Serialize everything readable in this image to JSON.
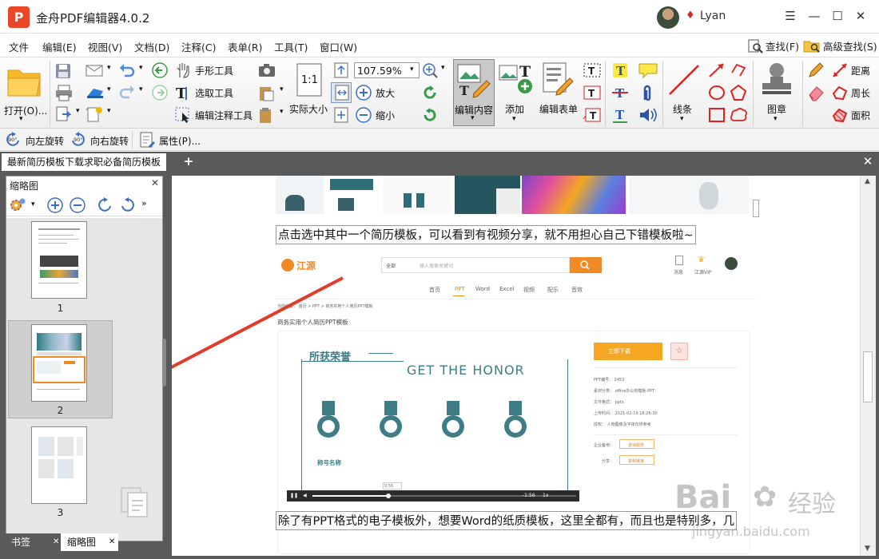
{
  "app": {
    "title": "金舟PDF编辑器4.0.2",
    "logo_letter": "P",
    "username": "Lyan"
  },
  "menu": {
    "items": [
      "文件",
      "编辑(E)",
      "视图(V)",
      "文档(D)",
      "注释(C)",
      "表单(R)",
      "工具(T)",
      "窗口(W)"
    ],
    "find": "查找(F)",
    "advanced_find": "高级查找(S)"
  },
  "ribbon": {
    "open": "打开(O)...",
    "hand_tool": "手形工具",
    "select_tool": "选取工具",
    "edit_annotation_tool": "编辑注释工具",
    "actual_size": "实际大小",
    "zoom_value": "107.59%",
    "zoom_in": "放大",
    "zoom_out": "缩小",
    "edit_content": "编辑内容",
    "add": "添加",
    "edit_form": "编辑表单",
    "line": "线条",
    "stamp": "图章",
    "distance": "距离",
    "perimeter": "周长",
    "area": "面积",
    "text_icon_letter": "T",
    "actual_size_icon": "1:1"
  },
  "toolbar2": {
    "rotate_left": "向左旋转",
    "rotate_right": "向右旋转",
    "properties": "属性(P)...",
    "rotate_badge": "90°"
  },
  "document": {
    "tab_title": "最新简历模板下载求职必备简历模板",
    "caption_1": "点击选中其中一个简历模板，可以看到有视频分享，就不用担心自己下错模板啦~",
    "caption_2": "除了有PPT格式的电子模板外，想要Word的纸质模板，这里全都有，而且也是特别多，几"
  },
  "thumbnails": {
    "panel_title": "缩略图",
    "pages": [
      "1",
      "2",
      "3"
    ],
    "selected_page": "2",
    "bottom_tabs": [
      "书签",
      "缩略图"
    ]
  },
  "embedded_site": {
    "logo": "江源",
    "search_category": "全部",
    "search_placeholder": "输入搜索关键词",
    "nav": [
      "首页",
      "PPT",
      "Word",
      "Excel",
      "视频",
      "配乐",
      "音效"
    ],
    "header_right": [
      "消息",
      "江源VIP"
    ],
    "breadcrumb": "当前位置：  首页  >  PPT  >  商务实用个人简历PPT模板",
    "item_title": "商务实用个人简历PPT模板",
    "slide_title": "所获荣誉",
    "slide_subtitle": "GET THE HONOR",
    "slide_label": "称号名称",
    "download_button": "立即下载",
    "meta": [
      "PPT编号：  2453",
      "素材分类：  office办公商模板-PPT",
      "文件格式：  pptx",
      "上传时间：  2021-02-19 18:26:30",
      "授权：  人物图像及字体仅供参考"
    ],
    "enterprise_label": "企业备用：",
    "enterprise_button": "咨询服务",
    "share_label": "分享：",
    "share_button": "复制链接",
    "video_time_current": "0:55",
    "video_time_total": "-1:56",
    "video_speed": "1x"
  },
  "watermark": {
    "brand": "Bai",
    "brand_cn": "经验",
    "url": "jingyan.baidu.com"
  },
  "colors": {
    "accent_orange": "#f08a24",
    "app_red": "#e8472a",
    "teal": "#3e7d86",
    "panel_gray": "#5a5a5a"
  }
}
